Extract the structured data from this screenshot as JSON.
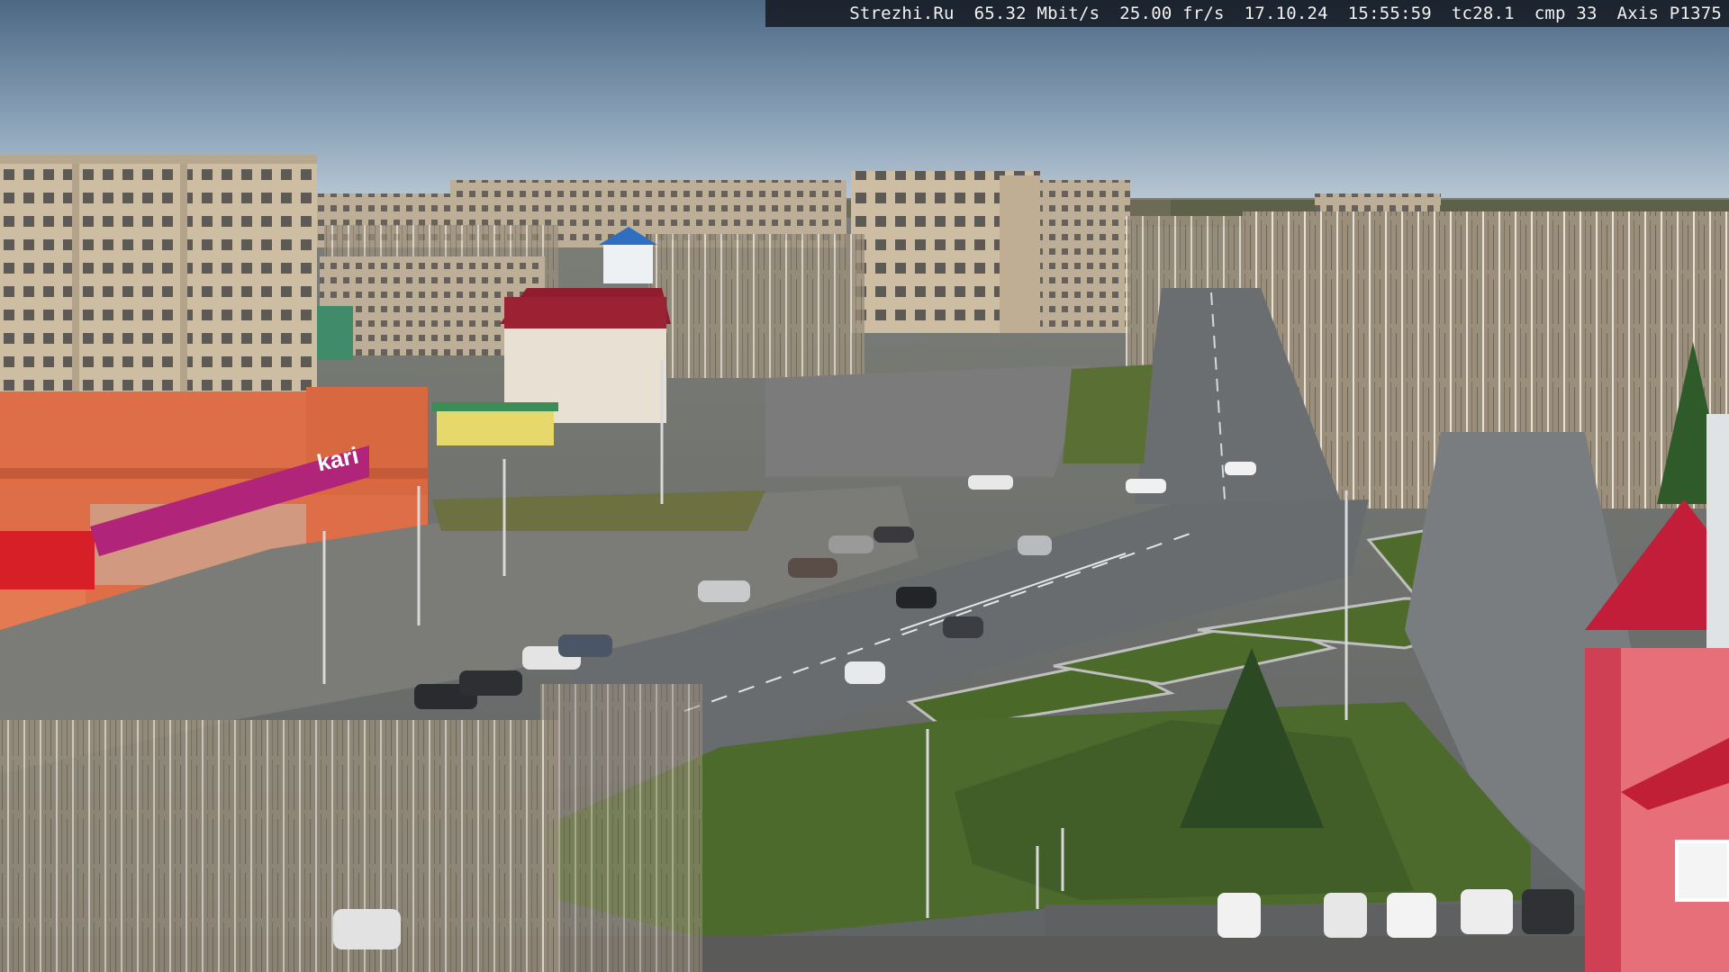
{
  "overlay": {
    "site": "Strezhi.Ru",
    "bitrate": "65.32 Mbit/s",
    "framerate": "25.00 fr/s",
    "date": "17.10.24",
    "time": "15:55:59",
    "tc": "tc28.1",
    "cmp": "cmp 33",
    "camera": "Axis P1375"
  },
  "signs": {
    "store_brand": "kari"
  },
  "colors": {
    "sky_top": "#4f6a86",
    "sky_bottom": "#b9c7d3",
    "asphalt": "#6e7173",
    "grass": "#4d6a2f",
    "panel_building": "#cfc0a6",
    "brick_building": "#e0704a",
    "kari_magenta": "#b0247a",
    "red_roof": "#c21e3a"
  }
}
